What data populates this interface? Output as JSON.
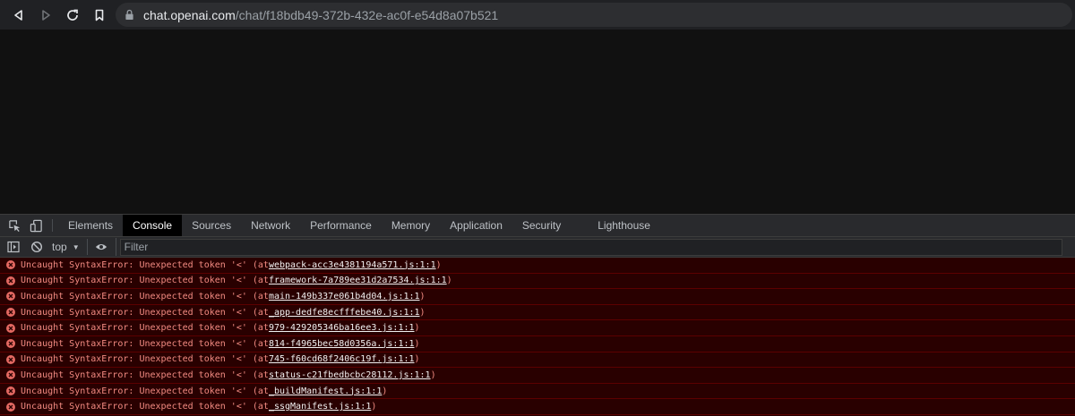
{
  "browser": {
    "url_host": "chat.openai.com",
    "url_path": "/chat/f18bdb49-372b-432e-ac0f-e54d8a07b521"
  },
  "devtools": {
    "tabs": [
      {
        "label": "Elements",
        "active": false
      },
      {
        "label": "Console",
        "active": true
      },
      {
        "label": "Sources",
        "active": false
      },
      {
        "label": "Network",
        "active": false
      },
      {
        "label": "Performance",
        "active": false
      },
      {
        "label": "Memory",
        "active": false
      },
      {
        "label": "Application",
        "active": false
      },
      {
        "label": "Security",
        "active": false
      },
      {
        "label": "Lighthouse",
        "active": false
      }
    ],
    "context": "top",
    "filter_placeholder": "Filter"
  },
  "console": {
    "error_color": "#f28b82",
    "messages": [
      {
        "prefix": "Uncaught SyntaxError: Unexpected token '<' (at ",
        "file": "webpack-acc3e4381194a571.js:1:1",
        "suffix": ")"
      },
      {
        "prefix": "Uncaught SyntaxError: Unexpected token '<' (at ",
        "file": "framework-7a789ee31d2a7534.js:1:1",
        "suffix": ")"
      },
      {
        "prefix": "Uncaught SyntaxError: Unexpected token '<' (at ",
        "file": "main-149b337e061b4d04.js:1:1",
        "suffix": ")"
      },
      {
        "prefix": "Uncaught SyntaxError: Unexpected token '<' (at ",
        "file": "_app-dedfe8ecfffebe40.js:1:1",
        "suffix": ")"
      },
      {
        "prefix": "Uncaught SyntaxError: Unexpected token '<' (at ",
        "file": "979-429205346ba16ee3.js:1:1",
        "suffix": ")"
      },
      {
        "prefix": "Uncaught SyntaxError: Unexpected token '<' (at ",
        "file": "814-f4965bec58d0356a.js:1:1",
        "suffix": ")"
      },
      {
        "prefix": "Uncaught SyntaxError: Unexpected token '<' (at ",
        "file": "745-f60cd68f2406c19f.js:1:1",
        "suffix": ")"
      },
      {
        "prefix": "Uncaught SyntaxError: Unexpected token '<' (at ",
        "file": "status-c21fbedbcbc28112.js:1:1",
        "suffix": ")"
      },
      {
        "prefix": "Uncaught SyntaxError: Unexpected token '<' (at ",
        "file": "_buildManifest.js:1:1",
        "suffix": ")"
      },
      {
        "prefix": "Uncaught SyntaxError: Unexpected token '<' (at ",
        "file": "_ssgManifest.js:1:1",
        "suffix": ")"
      }
    ]
  }
}
